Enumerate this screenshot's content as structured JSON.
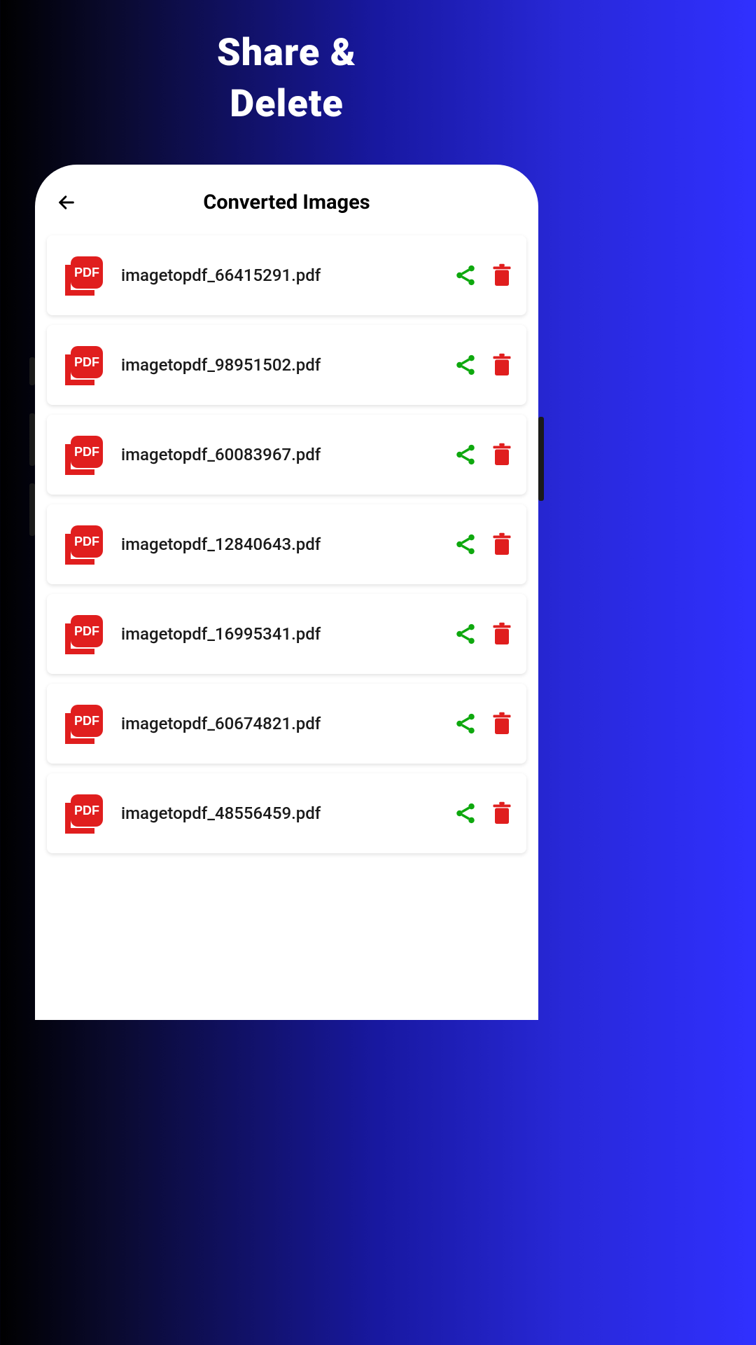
{
  "promo": {
    "line1": "Share &",
    "line2": "Delete"
  },
  "header": {
    "title": "Converted Images"
  },
  "colors": {
    "pdf_red": "#e01e1e",
    "share_green": "#0ea80e",
    "delete_red": "#e01e1e"
  },
  "files": [
    {
      "name": "imagetopdf_66415291.pdf"
    },
    {
      "name": "imagetopdf_98951502.pdf"
    },
    {
      "name": "imagetopdf_60083967.pdf"
    },
    {
      "name": "imagetopdf_12840643.pdf"
    },
    {
      "name": "imagetopdf_16995341.pdf"
    },
    {
      "name": "imagetopdf_60674821.pdf"
    },
    {
      "name": "imagetopdf_48556459.pdf"
    }
  ]
}
